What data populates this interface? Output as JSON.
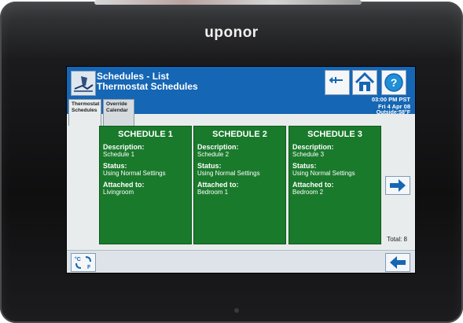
{
  "device": {
    "brand": "uponor"
  },
  "header": {
    "title": "Schedules - List",
    "subtitle": "Thermostat Schedules",
    "time": "03:00 PM PST",
    "date": "Fri 4 Apr 08",
    "outside": "Outside:58°F"
  },
  "tabs": [
    {
      "line1": "Thermostat",
      "line2": "Schedules",
      "active": true
    },
    {
      "line1": "Override",
      "line2": "Calendar",
      "active": false
    }
  ],
  "cards": [
    {
      "title": "SCHEDULE 1",
      "description_label": "Description:",
      "description": "Schedule 1",
      "status_label": "Status:",
      "status": "Using Normal Settings",
      "attached_label": "Attached to:",
      "attached": "Livingroom"
    },
    {
      "title": "SCHEDULE 2",
      "description_label": "Description:",
      "description": "Schedule 2",
      "status_label": "Status:",
      "status": "Using Normal Settings",
      "attached_label": "Attached to:",
      "attached": "Bedroom 1"
    },
    {
      "title": "SCHEDULE 3",
      "description_label": "Description:",
      "description": "Schedule 3",
      "status_label": "Status:",
      "status": "Using Normal Settings",
      "attached_label": "Attached to:",
      "attached": "Bedroom 2"
    }
  ],
  "total": "Total: 8",
  "footer": {
    "unit_toggle_c": "°C",
    "unit_toggle_f": "F"
  },
  "colors": {
    "header_blue": "#1566b4",
    "card_green": "#1a7a2c",
    "arrow_blue": "#1566b4"
  },
  "icons": {
    "schedule": "schedule-map-icon",
    "back_small": "back-arrow-small-icon",
    "home": "home-icon",
    "help": "help-icon",
    "next": "arrow-right-icon",
    "back": "arrow-left-icon",
    "unit_toggle": "temperature-unit-toggle-icon"
  }
}
